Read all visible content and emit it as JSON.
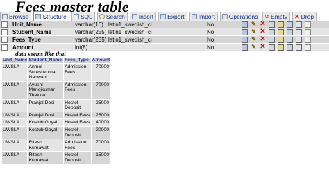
{
  "page": {
    "title": "Fees master table",
    "note": "data seems like that"
  },
  "tabs": [
    {
      "label": "Browse",
      "icon": "browse-icon"
    },
    {
      "label": "Structure",
      "icon": "structure-icon"
    },
    {
      "label": "SQL",
      "icon": "sql-icon"
    },
    {
      "label": "Search",
      "icon": "search-icon"
    },
    {
      "label": "Insert",
      "icon": "insert-icon"
    },
    {
      "label": "Export",
      "icon": "export-icon"
    },
    {
      "label": "Import",
      "icon": "import-icon"
    },
    {
      "label": "Operations",
      "icon": "operations-icon"
    },
    {
      "label": "Empty",
      "icon": "empty-icon"
    },
    {
      "label": "Drop",
      "icon": "drop-icon"
    }
  ],
  "structure": {
    "rows": [
      {
        "field": "Unit_Name",
        "type": "varchar(10)",
        "collation": "latin1_swedish_ci",
        "null": "No"
      },
      {
        "field": "Student_Name",
        "type": "varchar(255)",
        "collation": "latin1_swedish_ci",
        "null": "No"
      },
      {
        "field": "Fees_Type",
        "type": "varchar(255)",
        "collation": "latin1_swedish_ci",
        "null": "No"
      },
      {
        "field": "Amount",
        "type": "int(8)",
        "collation": "",
        "null": "No"
      }
    ]
  },
  "data": {
    "headers": [
      "Unit_Name",
      "Student_Name",
      "Fees_Type",
      "Amount"
    ],
    "rows": [
      {
        "unit": "UWSLA",
        "student": "Anmol Sureshkumar Nanwani",
        "fees_type": "Admission Fees",
        "amount": "70000"
      },
      {
        "unit": "UWSLA",
        "student": "Ayushi Manojkumar Thakker",
        "fees_type": "Admission Fees",
        "amount": "70000"
      },
      {
        "unit": "UWSLA",
        "student": "Pranjal Dosi",
        "fees_type": "Hostel Deposit",
        "amount": "25000"
      },
      {
        "unit": "UWSLA",
        "student": "Pranjal Dosi",
        "fees_type": "Hostel Fees",
        "amount": "25000"
      },
      {
        "unit": "UWSLA",
        "student": "Kostub Goyal",
        "fees_type": "Hostel Fees",
        "amount": "40000"
      },
      {
        "unit": "UWSLA",
        "student": "Kostub Goyal",
        "fees_type": "Hostel Deposit",
        "amount": "20000"
      },
      {
        "unit": "UWSLA",
        "student": "Ritesh Kumawat",
        "fees_type": "Admission Fees",
        "amount": "70000"
      },
      {
        "unit": "UWSLA",
        "student": "Ritesh Kumawat",
        "fees_type": "Hostel Deposit",
        "amount": "15000"
      }
    ]
  }
}
